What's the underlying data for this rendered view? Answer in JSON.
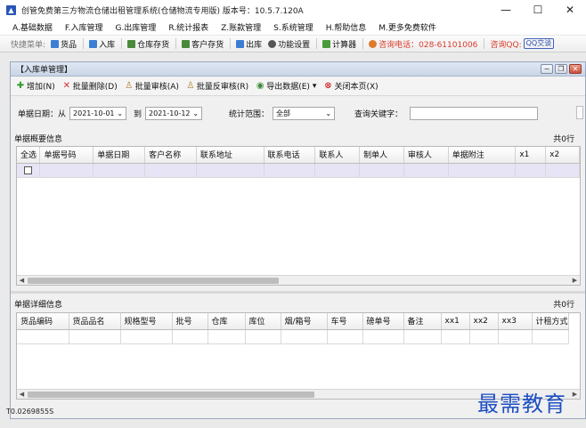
{
  "window": {
    "title": "创管免费第三方物流仓储出租管理系统(仓储物流专用版) 版本号：10.5.7.120A",
    "icon": "app-logo-icon",
    "controls": [
      "—",
      "☐",
      "✕"
    ]
  },
  "menu": {
    "items": [
      "A.基础数据",
      "F.入库管理",
      "G.出库管理",
      "R.统计报表",
      "Z.账款管理",
      "S.系统管理",
      "H.帮助信息",
      "M.更多免费软件"
    ]
  },
  "quickbar": {
    "label": "快捷菜单:",
    "items": [
      {
        "label": "货品",
        "icon": "goods-icon",
        "color": "#3b7fd4"
      },
      {
        "label": "入库",
        "icon": "inbound-arrow-icon",
        "color": "#3b7fd4"
      },
      {
        "label": "仓库存货",
        "icon": "bar-chart-icon",
        "color": "#4a8a3a"
      },
      {
        "label": "客户存货",
        "icon": "bar-chart-icon",
        "color": "#4a8a3a"
      },
      {
        "label": "出库",
        "icon": "outbound-arrow-icon",
        "color": "#3b7fd4"
      },
      {
        "label": "功能设置",
        "icon": "settings-icon",
        "color": "#555555"
      },
      {
        "label": "计算器",
        "icon": "calculator-icon",
        "color": "#4a9a3a"
      }
    ],
    "hotline": "咨询电话：028-61101006",
    "qq_label": "咨询QQ:",
    "qq_button": "QQ交谈"
  },
  "child_window": {
    "title": "【入库单管理】"
  },
  "toolbar": {
    "buttons": [
      {
        "label": "增加(N)",
        "icon": "add-plus-icon",
        "color": "#2e9b2e"
      },
      {
        "label": "批量删除(D)",
        "icon": "delete-x-icon",
        "color": "#d02a2a"
      },
      {
        "label": "批量审核(A)",
        "icon": "audit-user-icon",
        "color": "#b07a2a"
      },
      {
        "label": "批量反审核(R)",
        "icon": "unaudit-user-icon",
        "color": "#b07a2a"
      },
      {
        "label": "导出数据(E)",
        "icon": "export-icon",
        "color": "#3a8a3a",
        "dropdown": "▾"
      },
      {
        "label": "关闭本页(X)",
        "icon": "close-page-icon",
        "color": "#d02a2a"
      }
    ]
  },
  "filter": {
    "date_label": "单据日期：从",
    "date_from": "2021-10-01",
    "to_label": "到",
    "date_to": "2021-10-12",
    "scope_label": "统计范围：",
    "scope_value": "全部",
    "keyword_label": "查询关键字：",
    "keyword_value": ""
  },
  "summary": {
    "title": "单据概要信息",
    "count": "共0行",
    "columns": [
      "全选",
      "单据号码",
      "单据日期",
      "客户名称",
      "联系地址",
      "联系电话",
      "联系人",
      "制单人",
      "审核人",
      "单据附注",
      "x1",
      "x2"
    ]
  },
  "detail": {
    "title": "单据详细信息",
    "count": "共0行",
    "columns": [
      "货品编码",
      "货品品名",
      "规格型号",
      "批号",
      "仓库",
      "库位",
      "烟/箱号",
      "车号",
      "磅单号",
      "备注",
      "xx1",
      "xx2",
      "xx3",
      "计租方式"
    ]
  },
  "status": {
    "text": "T0.0269855S"
  },
  "watermark": "最需教育"
}
